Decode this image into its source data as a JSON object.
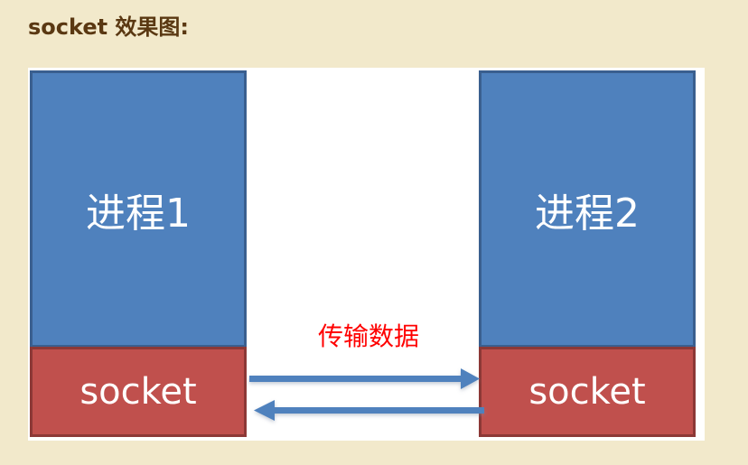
{
  "heading": "socket 效果图:",
  "diagram": {
    "left_process": {
      "label": "进程1",
      "socket_label": "socket"
    },
    "right_process": {
      "label": "进程2",
      "socket_label": "socket"
    },
    "transfer_label": "传输数据"
  },
  "colors": {
    "page_background": "#f2e9cb",
    "process_fill": "#4f81bd",
    "socket_fill": "#c0504d",
    "arrow": "#4f81bd",
    "transfer_label": "#ff0000"
  }
}
